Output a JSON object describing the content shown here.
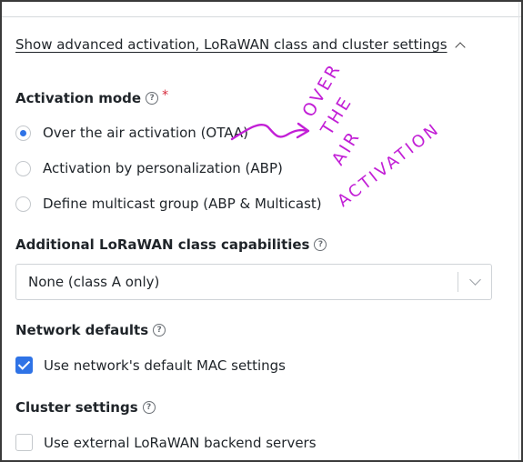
{
  "advanced_toggle": {
    "label": "Show advanced activation, LoRaWAN class and cluster settings",
    "icon": "chevron-up-icon"
  },
  "activation_mode": {
    "title": "Activation mode",
    "required_mark": "*",
    "options": [
      {
        "label": "Over the air activation (OTAA)",
        "selected": true
      },
      {
        "label": "Activation by personalization (ABP)",
        "selected": false
      },
      {
        "label": "Define multicast group (ABP & Multicast)",
        "selected": false
      }
    ]
  },
  "class_capabilities": {
    "title": "Additional LoRaWAN class capabilities",
    "selected_value": "None (class A only)"
  },
  "network_defaults": {
    "title": "Network defaults",
    "checkbox_label": "Use network's default MAC settings",
    "checked": true
  },
  "cluster_settings": {
    "title": "Cluster settings",
    "checkbox_label": "Use external LoRaWAN backend servers",
    "checked": false
  },
  "handwritten_note": {
    "lines": [
      "OVER",
      "THE",
      "AIR",
      "ACTIVATION"
    ],
    "color": "#c21fd6"
  },
  "colors": {
    "accent": "#2f73e6",
    "required": "#d62a3c",
    "annotation": "#c21fd6"
  }
}
